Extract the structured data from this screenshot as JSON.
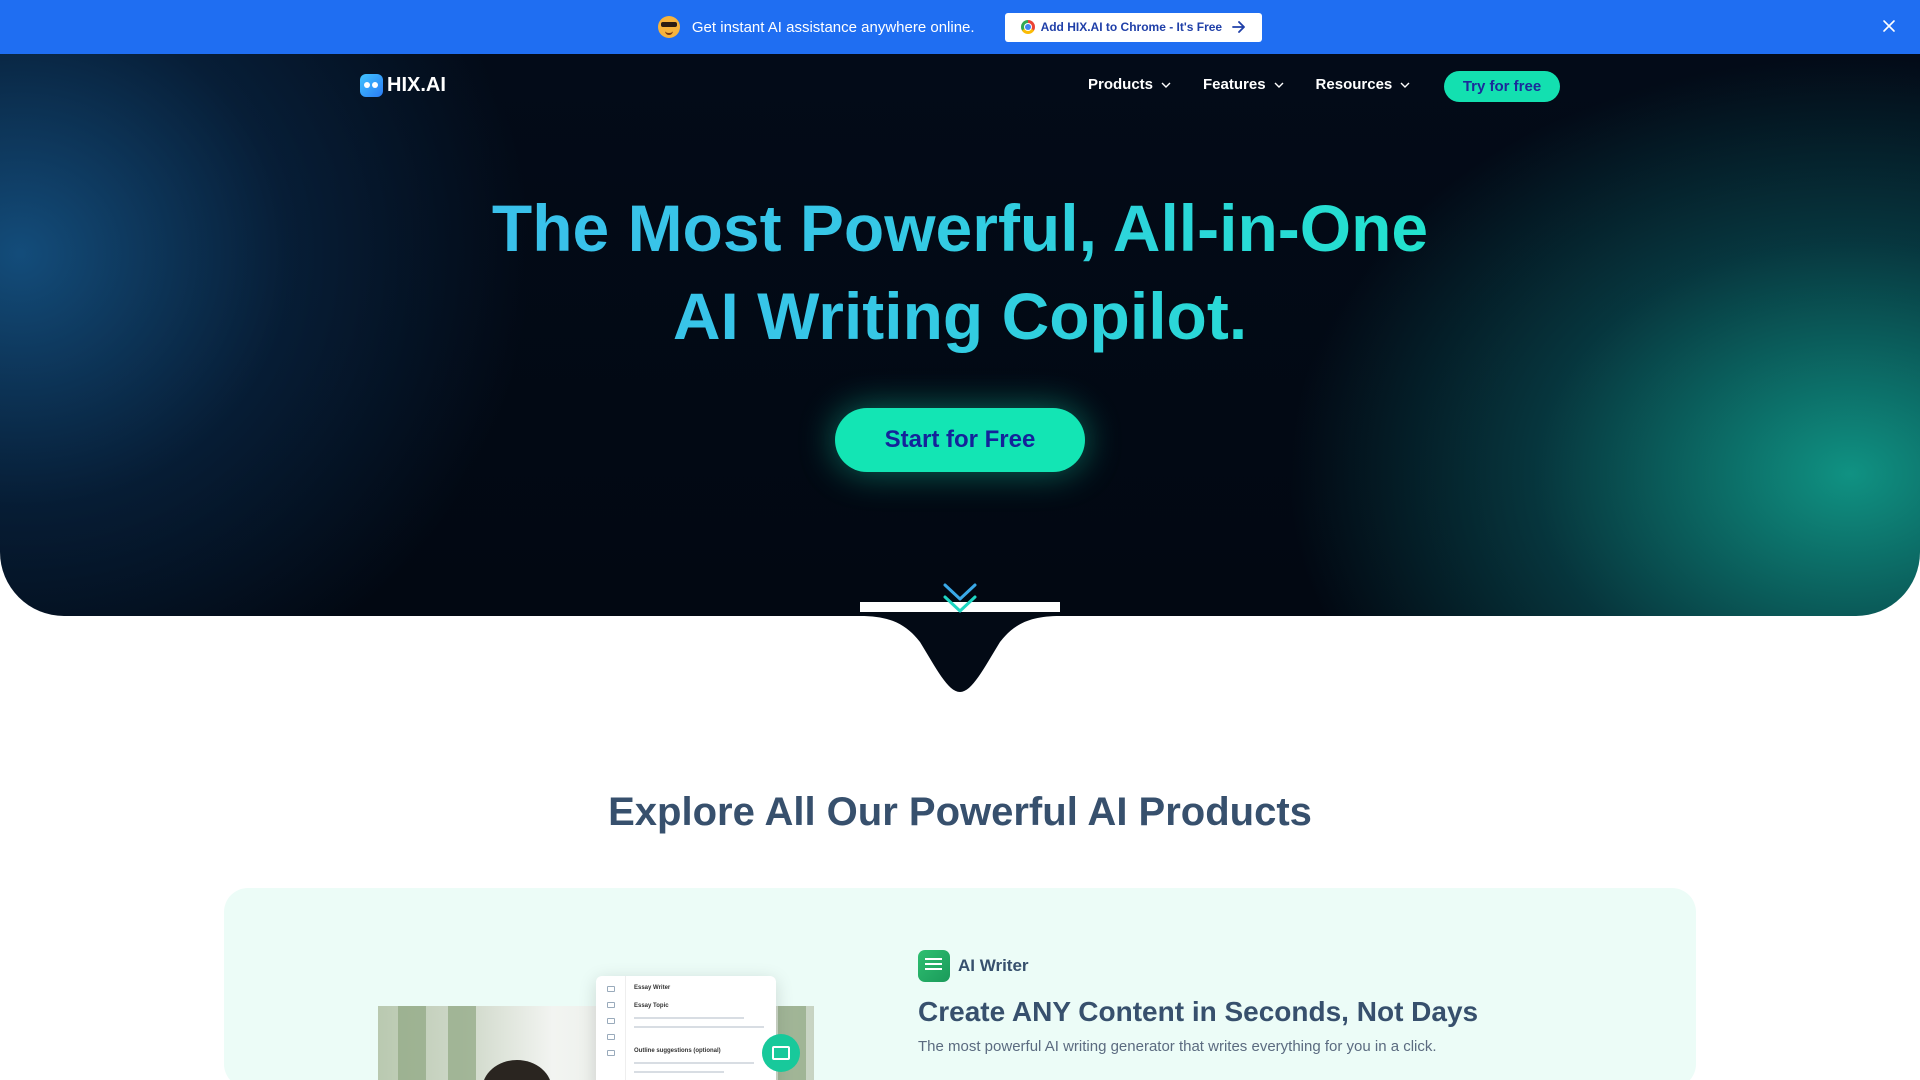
{
  "promo": {
    "text": "Get instant AI assistance anywhere online.",
    "button_label": "Add HIX.AI to Chrome - It's Free",
    "emoji_icon": "sunglasses-face-icon",
    "bg_color": "#1f6ef2"
  },
  "nav": {
    "logo_text": "HIX.AI",
    "links": [
      {
        "label": "Products"
      },
      {
        "label": "Features"
      },
      {
        "label": "Resources"
      }
    ],
    "cta_label": "Try for free"
  },
  "hero": {
    "title_line1": "The Most Powerful, All-in-One",
    "title_line2": "AI Writing Copilot.",
    "cta_label": "Start for Free",
    "accent_color": "#13e5b4"
  },
  "products_section": {
    "title": "Explore All Our Powerful AI Products",
    "card": {
      "tag": "AI Writer",
      "title": "Create ANY Content in Seconds, Not Days",
      "description": "The most powerful AI writing generator that writes everything for you in a click.",
      "mock_app": {
        "window_title": "Essay Writer",
        "field1_label": "Essay Topic",
        "field2_label": "Outline suggestions (optional)"
      }
    }
  }
}
